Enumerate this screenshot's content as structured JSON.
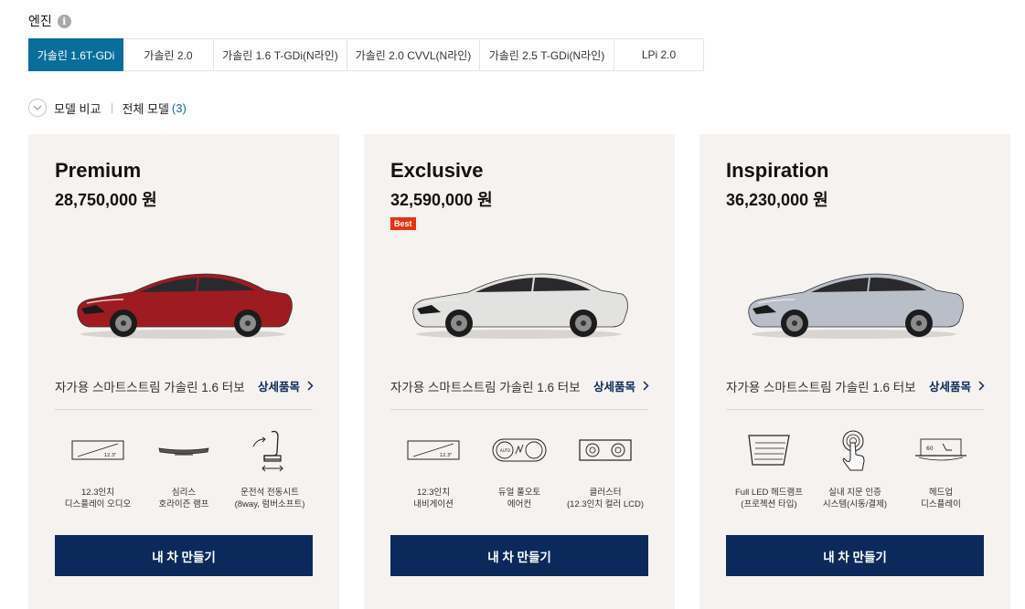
{
  "engine": {
    "label": "엔진",
    "info_icon": "i"
  },
  "tabs": [
    {
      "label": "가솔린 1.6T-GDi",
      "active": true
    },
    {
      "label": "가솔린 2.0",
      "active": false
    },
    {
      "label": "가솔린 1.6 T-GDi(N라인)",
      "active": false
    },
    {
      "label": "가솔린 2.0 CVVL(N라인)",
      "active": false
    },
    {
      "label": "가솔린 2.5 T-GDi(N라인)",
      "active": false
    },
    {
      "label": "LPi 2.0",
      "active": false
    }
  ],
  "compare": {
    "label": "모델 비교",
    "all_models": "전체 모델",
    "count": "(3)"
  },
  "colors": {
    "accent": "#0a6e9a",
    "navy": "#0b2a5b",
    "best": "#e63312",
    "card_bg": "#f5f2f0"
  },
  "cards": [
    {
      "name": "Premium",
      "price": "28,750,000 원",
      "badge": "",
      "car_color": "#9e1b22",
      "desc": "자가용 스마트스트림 가솔린 1.6 터보",
      "detail": "상세품목",
      "features": [
        {
          "icon": "display-icon",
          "label": "12.3인치\n디스플레이 오디오"
        },
        {
          "icon": "horizon-lamp-icon",
          "label": "심리스\n호라이즌 램프"
        },
        {
          "icon": "power-seat-icon",
          "label": "운전석 전동시트\n(8way, 럼버소프트)"
        }
      ],
      "build": "내 차 만들기"
    },
    {
      "name": "Exclusive",
      "price": "32,590,000 원",
      "badge": "Best",
      "car_color": "#e2e2e0",
      "desc": "자가용 스마트스트림 가솔린 1.6 터보",
      "detail": "상세품목",
      "features": [
        {
          "icon": "navigation-display-icon",
          "label": "12.3인치\n내비게이션"
        },
        {
          "icon": "dual-aircon-icon",
          "label": "듀얼 풀오토\n에어컨"
        },
        {
          "icon": "cluster-icon",
          "label": "클러스터\n(12.3인치 컬러 LCD)"
        }
      ],
      "build": "내 차 만들기"
    },
    {
      "name": "Inspiration",
      "price": "36,230,000 원",
      "badge": "",
      "car_color": "#b9bfc9",
      "desc": "자가용 스마트스트림 가솔린 1.6 터보",
      "detail": "상세품목",
      "features": [
        {
          "icon": "led-headlamp-icon",
          "label": "Full LED 헤드램프\n(프로젝션 타입)"
        },
        {
          "icon": "fingerprint-icon",
          "label": "실내 지문 인증\n시스템(시동/결제)"
        },
        {
          "icon": "hud-icon",
          "label": "헤드업\n디스플레이"
        }
      ],
      "build": "내 차 만들기"
    }
  ]
}
